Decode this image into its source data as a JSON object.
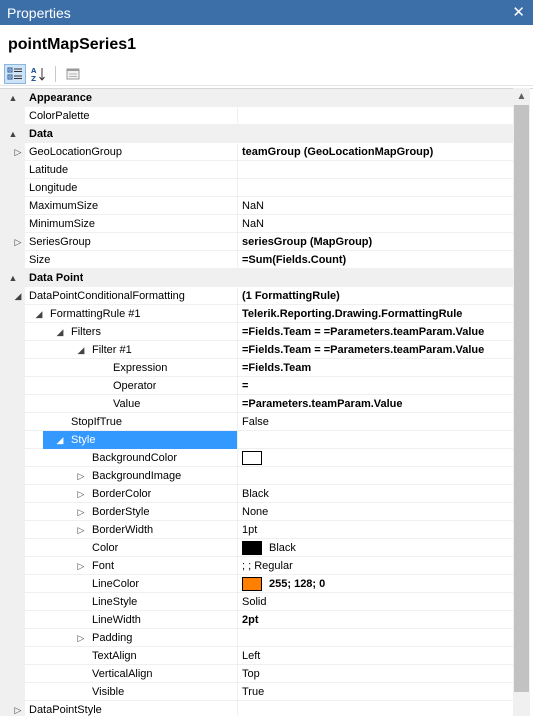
{
  "window": {
    "title": "Properties",
    "close_glyph": "✕"
  },
  "object_name": "pointMapSeries1",
  "toolbar": {
    "buttons": [
      {
        "icon": "categorized-icon",
        "active": true
      },
      {
        "icon": "alphabetical-sort-icon",
        "active": false
      },
      {
        "icon": "property-pages-icon",
        "active": false
      }
    ]
  },
  "colors": {
    "titlebar": "#3c6fa8",
    "selection": "#3399ff",
    "category_bg": "#f0f0f0"
  },
  "rows": [
    {
      "type": "category",
      "name": "Appearance",
      "expander": "▲",
      "level": 0
    },
    {
      "type": "prop",
      "name": "ColorPalette",
      "value": "",
      "level": 1
    },
    {
      "type": "category",
      "name": "Data",
      "expander": "▲",
      "level": 0
    },
    {
      "type": "prop",
      "name": "GeoLocationGroup",
      "value": "teamGroup (GeoLocationMapGroup)",
      "bold": true,
      "expander": "▷",
      "level": 1
    },
    {
      "type": "prop",
      "name": "Latitude",
      "value": "",
      "level": 1
    },
    {
      "type": "prop",
      "name": "Longitude",
      "value": "",
      "level": 1
    },
    {
      "type": "prop",
      "name": "MaximumSize",
      "value": "NaN",
      "level": 1
    },
    {
      "type": "prop",
      "name": "MinimumSize",
      "value": "NaN",
      "level": 1
    },
    {
      "type": "prop",
      "name": "SeriesGroup",
      "value": "seriesGroup (MapGroup)",
      "bold": true,
      "expander": "▷",
      "level": 1
    },
    {
      "type": "prop",
      "name": "Size",
      "value": "=Sum(Fields.Count)",
      "bold": true,
      "level": 1
    },
    {
      "type": "category",
      "name": "Data Point",
      "expander": "▲",
      "level": 0
    },
    {
      "type": "prop",
      "name": "DataPointConditionalFormatting",
      "value": "(1 FormattingRule)",
      "bold": true,
      "expander": "◢",
      "level": 1
    },
    {
      "type": "prop",
      "name": "FormattingRule #1",
      "value": "Telerik.Reporting.Drawing.FormattingRule",
      "bold": true,
      "expander": "◢",
      "level": 2
    },
    {
      "type": "prop",
      "name": "Filters",
      "value": "=Fields.Team = =Parameters.teamParam.Value",
      "bold": true,
      "expander": "◢",
      "level": 3
    },
    {
      "type": "prop",
      "name": "Filter #1",
      "value": "=Fields.Team = =Parameters.teamParam.Value",
      "bold": true,
      "expander": "◢",
      "level": 4
    },
    {
      "type": "prop",
      "name": "Expression",
      "value": "=Fields.Team",
      "bold": true,
      "level": 5
    },
    {
      "type": "prop",
      "name": "Operator",
      "value": "=",
      "bold": true,
      "level": 5
    },
    {
      "type": "prop",
      "name": "Value",
      "value": "=Parameters.teamParam.Value",
      "bold": true,
      "level": 5
    },
    {
      "type": "prop",
      "name": "StopIfTrue",
      "value": "False",
      "level": 3
    },
    {
      "type": "prop",
      "name": "Style",
      "value": "",
      "expander": "◢",
      "level": 3,
      "selected": true
    },
    {
      "type": "prop",
      "name": "BackgroundColor",
      "value": "",
      "swatch": "#ffffff",
      "level": 4
    },
    {
      "type": "prop",
      "name": "BackgroundImage",
      "value": "",
      "expander": "▷",
      "level": 4
    },
    {
      "type": "prop",
      "name": "BorderColor",
      "value": "Black",
      "expander": "▷",
      "level": 4
    },
    {
      "type": "prop",
      "name": "BorderStyle",
      "value": "None",
      "expander": "▷",
      "level": 4
    },
    {
      "type": "prop",
      "name": "BorderWidth",
      "value": "1pt",
      "expander": "▷",
      "level": 4
    },
    {
      "type": "prop",
      "name": "Color",
      "value": "Black",
      "swatch": "#000000",
      "level": 4
    },
    {
      "type": "prop",
      "name": "Font",
      "value": "; ; Regular",
      "expander": "▷",
      "level": 4
    },
    {
      "type": "prop",
      "name": "LineColor",
      "value": "255; 128; 0",
      "bold": true,
      "swatch": "#ff8000",
      "level": 4
    },
    {
      "type": "prop",
      "name": "LineStyle",
      "value": "Solid",
      "level": 4
    },
    {
      "type": "prop",
      "name": "LineWidth",
      "value": "2pt",
      "bold": true,
      "level": 4
    },
    {
      "type": "prop",
      "name": "Padding",
      "value": "",
      "expander": "▷",
      "level": 4
    },
    {
      "type": "prop",
      "name": "TextAlign",
      "value": "Left",
      "level": 4
    },
    {
      "type": "prop",
      "name": "VerticalAlign",
      "value": "Top",
      "level": 4
    },
    {
      "type": "prop",
      "name": "Visible",
      "value": "True",
      "level": 4
    },
    {
      "type": "prop",
      "name": "DataPointStyle",
      "value": "",
      "expander": "▷",
      "level": 1
    }
  ],
  "scrollbar": {
    "up_glyph": "▲"
  }
}
